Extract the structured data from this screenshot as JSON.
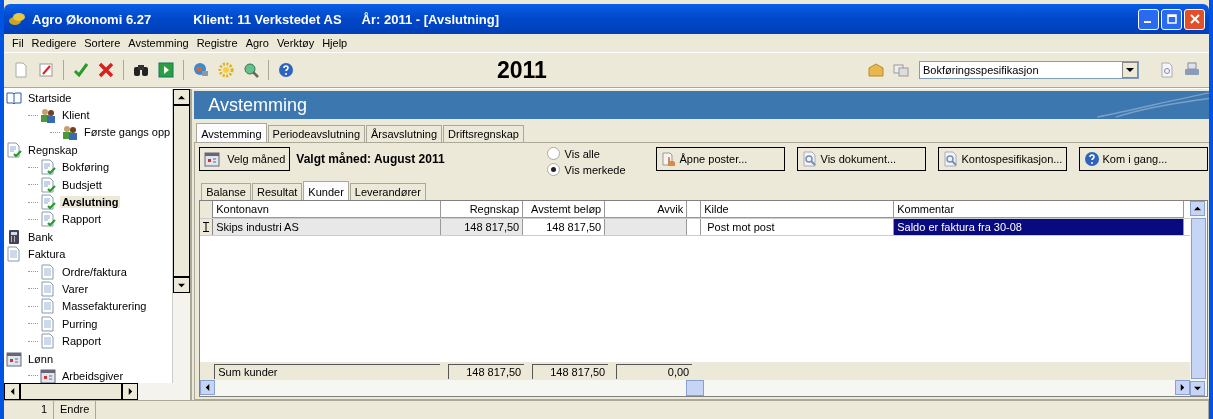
{
  "window": {
    "title": "Agro Økonomi 6.27",
    "client": "Klient:  11  Verkstedet AS",
    "year": "År: 2011 - [Avslutning]"
  },
  "menu": [
    "Fil",
    "Redigere",
    "Sortere",
    "Avstemming",
    "Registre",
    "Agro",
    "Verktøy",
    "Hjelp"
  ],
  "toolbar": {
    "year": "2011",
    "report_select": "Bokføringsspesifikasjon"
  },
  "sidebar": {
    "items": [
      {
        "label": "Startside",
        "kind": "book",
        "selected": false,
        "children": [
          {
            "label": "Klient",
            "kind": "people",
            "selected": false,
            "children": [
              {
                "label": "Første gangs opp",
                "kind": "people",
                "selected": false
              }
            ]
          }
        ]
      },
      {
        "label": "Regnskap",
        "kind": "doccheck",
        "selected": false,
        "children": [
          {
            "label": "Bokføring",
            "kind": "doccheck",
            "selected": false
          },
          {
            "label": "Budsjett",
            "kind": "doccheck",
            "selected": false
          },
          {
            "label": "Avslutning",
            "kind": "doccheck",
            "selected": true
          },
          {
            "label": "Rapport",
            "kind": "doccheck",
            "selected": false
          }
        ]
      },
      {
        "label": "Bank",
        "kind": "calculator",
        "selected": false
      },
      {
        "label": "Faktura",
        "kind": "doc",
        "selected": false,
        "children": [
          {
            "label": "Ordre/faktura",
            "kind": "doc",
            "selected": false
          },
          {
            "label": "Varer",
            "kind": "doc",
            "selected": false
          },
          {
            "label": "Massefakturering",
            "kind": "doc",
            "selected": false
          },
          {
            "label": "Purring",
            "kind": "doc",
            "selected": false
          },
          {
            "label": "Rapport",
            "kind": "doc",
            "selected": false
          }
        ]
      },
      {
        "label": "Lønn",
        "kind": "calendar",
        "selected": false,
        "children": [
          {
            "label": "Arbeidsgiver",
            "kind": "calendar",
            "selected": false
          }
        ]
      }
    ]
  },
  "panel": {
    "title": "Avstemming",
    "tabs": [
      {
        "label": "Avstemming",
        "selected": true
      },
      {
        "label": "Periodeavslutning",
        "selected": false
      },
      {
        "label": "Årsavslutning",
        "selected": false
      },
      {
        "label": "Driftsregnskap",
        "selected": false
      }
    ],
    "month_button": "Velg måned",
    "month_label": "Valgt måned: August 2011",
    "filter": [
      {
        "label": "Vis alle",
        "selected": false
      },
      {
        "label": "Vis merkede",
        "selected": true
      }
    ],
    "buttons": [
      {
        "label": "Åpne poster...",
        "kind": "hand"
      },
      {
        "label": "Vis dokument...",
        "kind": "magnifier"
      },
      {
        "label": "Kontospesifikasjon...",
        "kind": "magnifier"
      },
      {
        "label": "Kom i gang...",
        "kind": "help"
      }
    ],
    "subtabs": [
      {
        "label": "Balanse",
        "selected": false
      },
      {
        "label": "Resultat",
        "selected": false
      },
      {
        "label": "Kunder",
        "selected": true
      },
      {
        "label": "Leverandører",
        "selected": false
      }
    ],
    "table": {
      "columns": [
        "Kontonavn",
        "Regnskap",
        "Avstemt beløp",
        "Avvik",
        "Kilde",
        "Kommentar"
      ],
      "rows": [
        {
          "kontonavn": "Skips industri AS",
          "regnskap": "148 817,50",
          "avstemt": "148 817,50",
          "kilde": "Post mot post",
          "kommentar": "Saldo er faktura fra 30-08",
          "selected": true
        }
      ],
      "footer": {
        "label": "Sum kunder",
        "regnskap": "148 817,50",
        "avstemt": "148 817,50",
        "avvik": "0,00"
      }
    }
  },
  "status_bar": {
    "count": "1",
    "mode": "Endre"
  }
}
